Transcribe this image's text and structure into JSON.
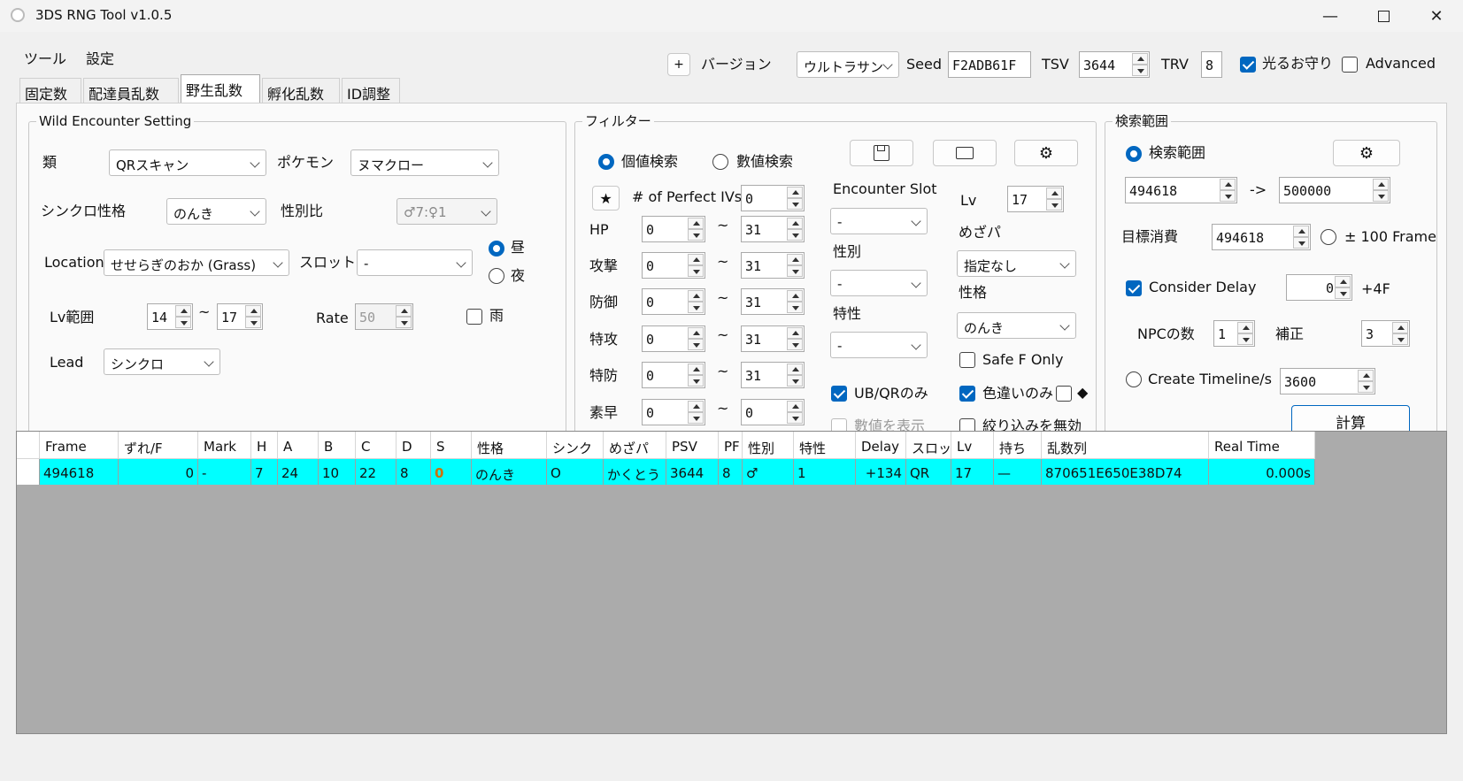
{
  "window": {
    "title": "3DS RNG Tool v1.0.5"
  },
  "menu": {
    "tools": "ツール",
    "settings": "設定"
  },
  "tabs": [
    {
      "label": "固定数"
    },
    {
      "label": "配達員乱数"
    },
    {
      "label": "野生乱数"
    },
    {
      "label": "孵化乱数"
    },
    {
      "label": "ID調整"
    }
  ],
  "topbar": {
    "plus": "+",
    "version_label": "バージョン",
    "version_value": "ウルトラサン",
    "seed_label": "Seed",
    "seed_value": "F2ADB61F",
    "tsv_label": "TSV",
    "tsv_value": "3644",
    "trv_label": "TRV",
    "trv_value": "8",
    "shiny_charm_label": "光るお守り",
    "advanced_label": "Advanced"
  },
  "wild": {
    "title": "Wild Encounter Setting",
    "type_label": "類",
    "type_value": "QRスキャン",
    "pokemon_label": "ポケモン",
    "pokemon_value": "ヌマクロー",
    "sync_label": "シンクロ性格",
    "sync_value": "のんき",
    "gender_ratio_label": "性別比",
    "gender_ratio_value": "♂7:♀1",
    "location_label": "Location",
    "location_value": "せせらぎのおか (Grass)",
    "slot_label": "スロット",
    "slot_value": "-",
    "day_label": "昼",
    "night_label": "夜",
    "lv_range_label": "Lv範囲",
    "lv_min": "14",
    "lv_sep": "~",
    "lv_max": "17",
    "rate_label": "Rate",
    "rate_value": "50",
    "rain_label": "雨",
    "lead_label": "Lead",
    "lead_value": "シンクロ"
  },
  "filter": {
    "title": "フィルター",
    "iv_search_label": "個値検索",
    "stat_search_label": "數値検索",
    "star": "★",
    "perfect_ivs_label": "# of Perfect IVs",
    "perfect_ivs_value": "0",
    "stats": [
      {
        "label": "HP",
        "min": "0",
        "max": "31"
      },
      {
        "label": "攻撃",
        "min": "0",
        "max": "31"
      },
      {
        "label": "防御",
        "min": "0",
        "max": "31"
      },
      {
        "label": "特攻",
        "min": "0",
        "max": "31"
      },
      {
        "label": "特防",
        "min": "0",
        "max": "31"
      },
      {
        "label": "素早",
        "min": "0",
        "max": "0"
      }
    ],
    "tilde": "~",
    "encounter_slot_label": "Encounter Slot",
    "encounter_slot_value": "-",
    "gender_label": "性別",
    "gender_value": "-",
    "ability_label": "特性",
    "ability_value": "-",
    "lv_label": "Lv",
    "lv_value": "17",
    "hp_type_label": "めざパ",
    "hp_type_value": "指定なし",
    "nature_label": "性格",
    "nature_value": "のんき",
    "safe_f_label": "Safe F Only",
    "ub_qr_label": "UB/QRのみ",
    "shiny_only_label": "色違いのみ",
    "diamond": "◆",
    "show_stats_label": "數値を表示",
    "disable_filter_label": "絞り込みを無効"
  },
  "search": {
    "title": "検索範囲",
    "range_label": "検索範囲",
    "from": "494618",
    "arrow": "->",
    "to": "500000",
    "target_label": "目標消費",
    "target_value": "494618",
    "frame_label": "± 100 Frame",
    "consider_delay_label": "Consider Delay",
    "delay_value": "0",
    "delay_suffix": "+4F",
    "npc_label": "NPCの数",
    "npc_value": "1",
    "correction_label": "補正",
    "correction_value": "3",
    "timeline_label": "Create Timeline/s",
    "timeline_value": "3600",
    "calc_button": "計算"
  },
  "table": {
    "columns": [
      "Frame",
      "ずれ/F",
      "Mark",
      "H",
      "A",
      "B",
      "C",
      "D",
      "S",
      "性格",
      "シンク",
      "めざパ",
      "PSV",
      "PF",
      "性別",
      "特性",
      "Delay",
      "スロッ",
      "Lv",
      "持ち",
      "乱数列",
      "Real Time"
    ],
    "rows": [
      [
        "494618",
        "0",
        "-",
        "7",
        "24",
        "10",
        "22",
        "8",
        "0",
        "のんき",
        "O",
        "かくとう",
        "3644",
        "8",
        "♂",
        "1",
        "+134",
        "QR",
        "17",
        "—",
        "870651E650E38D74",
        "0.000s"
      ]
    ]
  },
  "colors": {
    "accent": "#0067c0",
    "row_highlight": "#00ffff",
    "s_value": "#d07000"
  }
}
